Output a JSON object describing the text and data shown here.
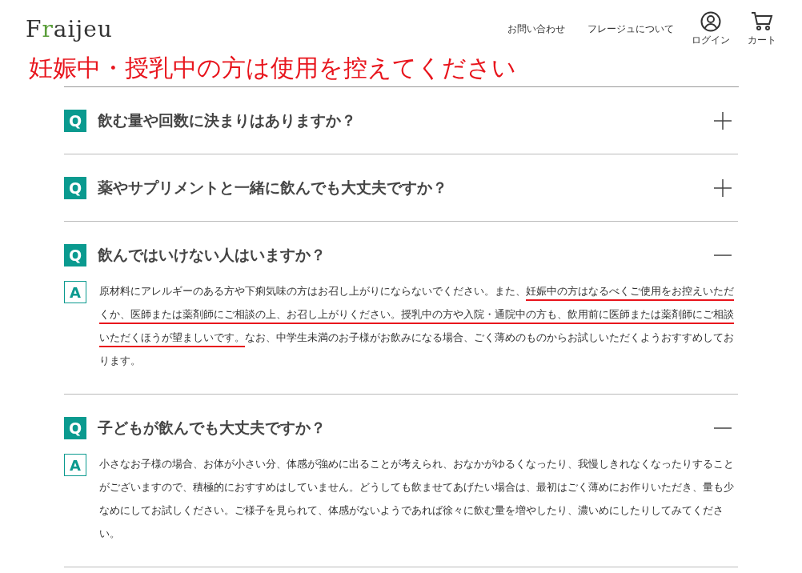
{
  "header": {
    "logo": "Fraijeu",
    "nav": [
      "お問い合わせ",
      "フレージュについて"
    ],
    "icons": [
      {
        "kind": "user",
        "label": "ログイン"
      },
      {
        "kind": "cart",
        "label": "カート"
      }
    ]
  },
  "notice": "妊娠中・授乳中の方は使用を控えてください",
  "faq": [
    {
      "q_mark": "Q",
      "question": "飲む量や回数に決まりはありますか？",
      "expanded": false
    },
    {
      "q_mark": "Q",
      "question": "薬やサプリメントと一緒に飲んでも大丈夫ですか？",
      "expanded": false
    },
    {
      "q_mark": "Q",
      "question": "飲んではいけない人はいますか？",
      "expanded": true,
      "a_mark": "A",
      "answer": [
        {
          "text": "原材料にアレルギーのある方や下痢気味の方はお召し上がりにならないでください。また、",
          "underlined": false
        },
        {
          "text": "妊娠中の方はなるべくご使用をお控えいただくか、医師または薬剤師にご相談の上、お召し上がりください。授乳中の方や入院・通院中の方も、飲用前に医師または薬剤師にご相談いただくほうが望ましいです。",
          "underlined": true
        },
        {
          "text": "なお、中学生未満のお子様がお飲みになる場合、ごく薄めのものからお試しいただくようおすすめしております。",
          "underlined": false
        }
      ]
    },
    {
      "q_mark": "Q",
      "question": "子どもが飲んでも大丈夫ですか？",
      "expanded": true,
      "a_mark": "A",
      "answer": [
        {
          "text": "小さなお子様の場合、お体が小さい分、体感が強めに出ることが考えられ、おなかがゆるくなったり、我慢しきれなくなったりすることがございますので、積極的におすすめはしていません。どうしても飲ませてあげたい場合は、最初はごく薄めにお作りいただき、量も少なめにしてお試しください。ご様子を見られて、体感がないようであれば徐々に飲む量を増やしたり、濃いめにしたりしてみてください。",
          "underlined": false
        }
      ]
    }
  ]
}
